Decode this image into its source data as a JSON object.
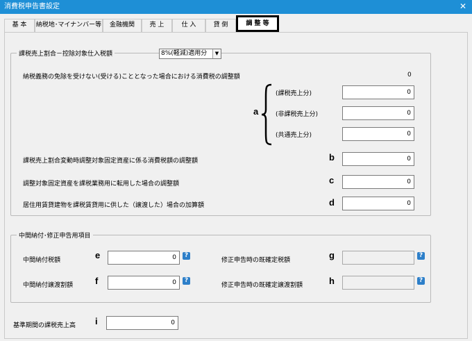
{
  "window": {
    "title": "消費税申告書設定",
    "close_glyph": "✕"
  },
  "tabs": [
    {
      "label": "基 本"
    },
    {
      "label": "納税地･マイナンバー等"
    },
    {
      "label": "金融機関"
    },
    {
      "label": "売 上"
    },
    {
      "label": "仕 入"
    },
    {
      "label": "貸 倒"
    },
    {
      "label": "調 整 等"
    }
  ],
  "group1": {
    "title": "課税売上割合－控除対象仕入税額",
    "rate_select": "8%(軽減)適用分",
    "exemption_label": "納税義務の免除を受けない(受ける)こととなった場合における消費税の調整額",
    "exemption_value": "0",
    "letter_a": "a",
    "sub_items": [
      {
        "label": "(課税売上分)",
        "value": "0"
      },
      {
        "label": "(非課税売上分)",
        "value": "0"
      },
      {
        "label": "(共通売上分)",
        "value": "0"
      }
    ],
    "item_b": {
      "label": "課税売上割合変動時調整対象固定資産に係る消費税額の調整額",
      "letter": "b",
      "value": "0"
    },
    "item_c": {
      "label": "調整対象固定資産を課税業務用に転用した場合の調整額",
      "letter": "c",
      "value": "0"
    },
    "item_d": {
      "label": "居住用賃貸建物を課税賃貸用に供した（譲渡した）場合の加算額",
      "letter": "d",
      "value": "0"
    }
  },
  "group2": {
    "title": "中間納付･修正申告用項目",
    "item_e": {
      "label": "中間納付税額",
      "letter": "e",
      "value": "0"
    },
    "item_f": {
      "label": "中間納付譲渡割額",
      "letter": "f",
      "value": "0"
    },
    "item_g": {
      "label": "修正申告時の既確定税額",
      "letter": "g",
      "value": ""
    },
    "item_h": {
      "label": "修正申告時の既確定譲渡割額",
      "letter": "h",
      "value": ""
    },
    "help_glyph": "?"
  },
  "item_i": {
    "label": "基準期間の課税売上高",
    "letter": "i",
    "value": "0"
  },
  "colors": {
    "titlebar": "#1e8fd6",
    "help": "#2d7fc9"
  }
}
